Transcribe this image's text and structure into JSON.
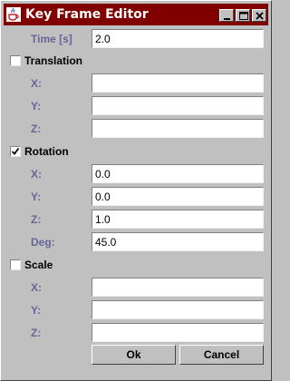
{
  "window": {
    "title": "Key Frame Editor",
    "title_bar_color": "#800000"
  },
  "time": {
    "label": "Time [s]",
    "value": "2.0"
  },
  "translation": {
    "label": "Translation",
    "checked": false,
    "x": {
      "label": "X:",
      "value": ""
    },
    "y": {
      "label": "Y:",
      "value": ""
    },
    "z": {
      "label": "Z:",
      "value": ""
    }
  },
  "rotation": {
    "label": "Rotation",
    "checked": true,
    "x": {
      "label": "X:",
      "value": "0.0"
    },
    "y": {
      "label": "Y:",
      "value": "0.0"
    },
    "z": {
      "label": "Z:",
      "value": "1.0"
    },
    "deg": {
      "label": "Deg:",
      "value": "45.0"
    }
  },
  "scale": {
    "label": "Scale",
    "checked": false,
    "x": {
      "label": "X:",
      "value": ""
    },
    "y": {
      "label": "Y:",
      "value": ""
    },
    "z": {
      "label": "Z:",
      "value": ""
    }
  },
  "buttons": {
    "ok": "Ok",
    "cancel": "Cancel"
  },
  "icons": {
    "app": "java-cup-icon",
    "minimize": "minimize-icon",
    "maximize": "maximize-icon",
    "close": "close-icon",
    "check": "checkmark-icon"
  },
  "colors": {
    "label": "#666699",
    "background": "#c0c0c0"
  }
}
